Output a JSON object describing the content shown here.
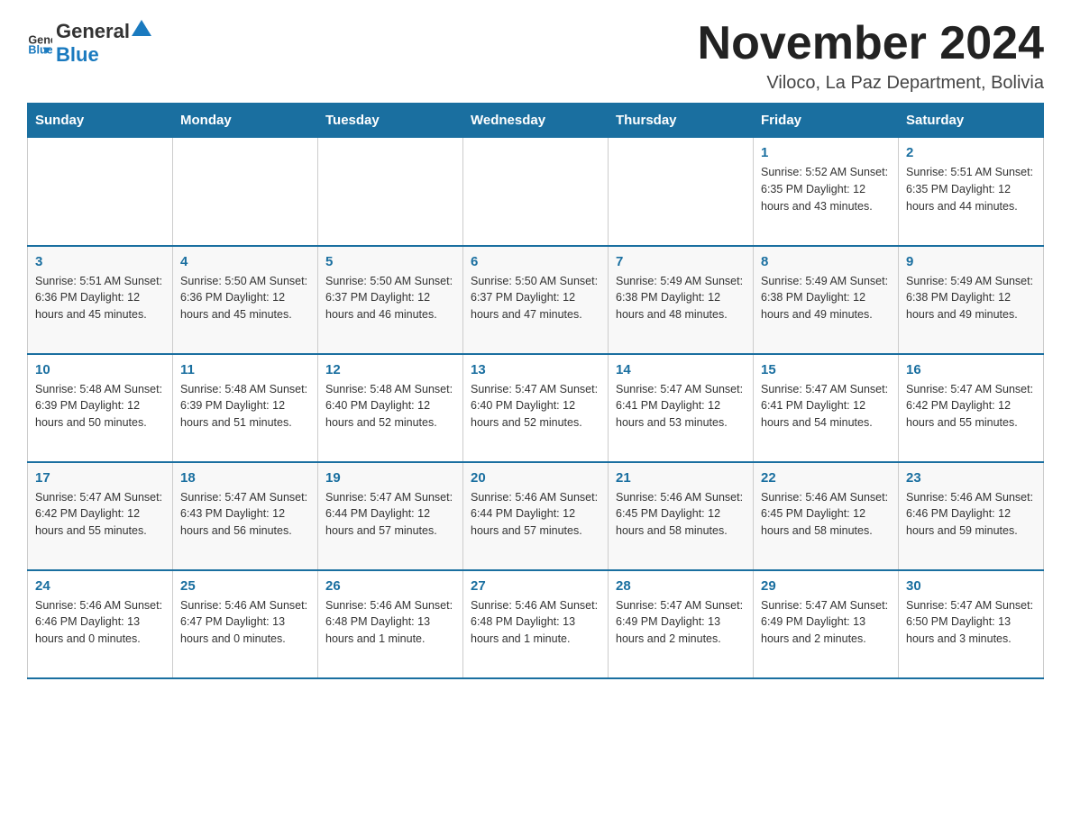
{
  "header": {
    "logo_general": "General",
    "logo_blue": "Blue",
    "title": "November 2024",
    "subtitle": "Viloco, La Paz Department, Bolivia"
  },
  "days_of_week": [
    "Sunday",
    "Monday",
    "Tuesday",
    "Wednesday",
    "Thursday",
    "Friday",
    "Saturday"
  ],
  "weeks": [
    [
      {
        "day": "",
        "info": ""
      },
      {
        "day": "",
        "info": ""
      },
      {
        "day": "",
        "info": ""
      },
      {
        "day": "",
        "info": ""
      },
      {
        "day": "",
        "info": ""
      },
      {
        "day": "1",
        "info": "Sunrise: 5:52 AM\nSunset: 6:35 PM\nDaylight: 12 hours and 43 minutes."
      },
      {
        "day": "2",
        "info": "Sunrise: 5:51 AM\nSunset: 6:35 PM\nDaylight: 12 hours and 44 minutes."
      }
    ],
    [
      {
        "day": "3",
        "info": "Sunrise: 5:51 AM\nSunset: 6:36 PM\nDaylight: 12 hours and 45 minutes."
      },
      {
        "day": "4",
        "info": "Sunrise: 5:50 AM\nSunset: 6:36 PM\nDaylight: 12 hours and 45 minutes."
      },
      {
        "day": "5",
        "info": "Sunrise: 5:50 AM\nSunset: 6:37 PM\nDaylight: 12 hours and 46 minutes."
      },
      {
        "day": "6",
        "info": "Sunrise: 5:50 AM\nSunset: 6:37 PM\nDaylight: 12 hours and 47 minutes."
      },
      {
        "day": "7",
        "info": "Sunrise: 5:49 AM\nSunset: 6:38 PM\nDaylight: 12 hours and 48 minutes."
      },
      {
        "day": "8",
        "info": "Sunrise: 5:49 AM\nSunset: 6:38 PM\nDaylight: 12 hours and 49 minutes."
      },
      {
        "day": "9",
        "info": "Sunrise: 5:49 AM\nSunset: 6:38 PM\nDaylight: 12 hours and 49 minutes."
      }
    ],
    [
      {
        "day": "10",
        "info": "Sunrise: 5:48 AM\nSunset: 6:39 PM\nDaylight: 12 hours and 50 minutes."
      },
      {
        "day": "11",
        "info": "Sunrise: 5:48 AM\nSunset: 6:39 PM\nDaylight: 12 hours and 51 minutes."
      },
      {
        "day": "12",
        "info": "Sunrise: 5:48 AM\nSunset: 6:40 PM\nDaylight: 12 hours and 52 minutes."
      },
      {
        "day": "13",
        "info": "Sunrise: 5:47 AM\nSunset: 6:40 PM\nDaylight: 12 hours and 52 minutes."
      },
      {
        "day": "14",
        "info": "Sunrise: 5:47 AM\nSunset: 6:41 PM\nDaylight: 12 hours and 53 minutes."
      },
      {
        "day": "15",
        "info": "Sunrise: 5:47 AM\nSunset: 6:41 PM\nDaylight: 12 hours and 54 minutes."
      },
      {
        "day": "16",
        "info": "Sunrise: 5:47 AM\nSunset: 6:42 PM\nDaylight: 12 hours and 55 minutes."
      }
    ],
    [
      {
        "day": "17",
        "info": "Sunrise: 5:47 AM\nSunset: 6:42 PM\nDaylight: 12 hours and 55 minutes."
      },
      {
        "day": "18",
        "info": "Sunrise: 5:47 AM\nSunset: 6:43 PM\nDaylight: 12 hours and 56 minutes."
      },
      {
        "day": "19",
        "info": "Sunrise: 5:47 AM\nSunset: 6:44 PM\nDaylight: 12 hours and 57 minutes."
      },
      {
        "day": "20",
        "info": "Sunrise: 5:46 AM\nSunset: 6:44 PM\nDaylight: 12 hours and 57 minutes."
      },
      {
        "day": "21",
        "info": "Sunrise: 5:46 AM\nSunset: 6:45 PM\nDaylight: 12 hours and 58 minutes."
      },
      {
        "day": "22",
        "info": "Sunrise: 5:46 AM\nSunset: 6:45 PM\nDaylight: 12 hours and 58 minutes."
      },
      {
        "day": "23",
        "info": "Sunrise: 5:46 AM\nSunset: 6:46 PM\nDaylight: 12 hours and 59 minutes."
      }
    ],
    [
      {
        "day": "24",
        "info": "Sunrise: 5:46 AM\nSunset: 6:46 PM\nDaylight: 13 hours and 0 minutes."
      },
      {
        "day": "25",
        "info": "Sunrise: 5:46 AM\nSunset: 6:47 PM\nDaylight: 13 hours and 0 minutes."
      },
      {
        "day": "26",
        "info": "Sunrise: 5:46 AM\nSunset: 6:48 PM\nDaylight: 13 hours and 1 minute."
      },
      {
        "day": "27",
        "info": "Sunrise: 5:46 AM\nSunset: 6:48 PM\nDaylight: 13 hours and 1 minute."
      },
      {
        "day": "28",
        "info": "Sunrise: 5:47 AM\nSunset: 6:49 PM\nDaylight: 13 hours and 2 minutes."
      },
      {
        "day": "29",
        "info": "Sunrise: 5:47 AM\nSunset: 6:49 PM\nDaylight: 13 hours and 2 minutes."
      },
      {
        "day": "30",
        "info": "Sunrise: 5:47 AM\nSunset: 6:50 PM\nDaylight: 13 hours and 3 minutes."
      }
    ]
  ]
}
